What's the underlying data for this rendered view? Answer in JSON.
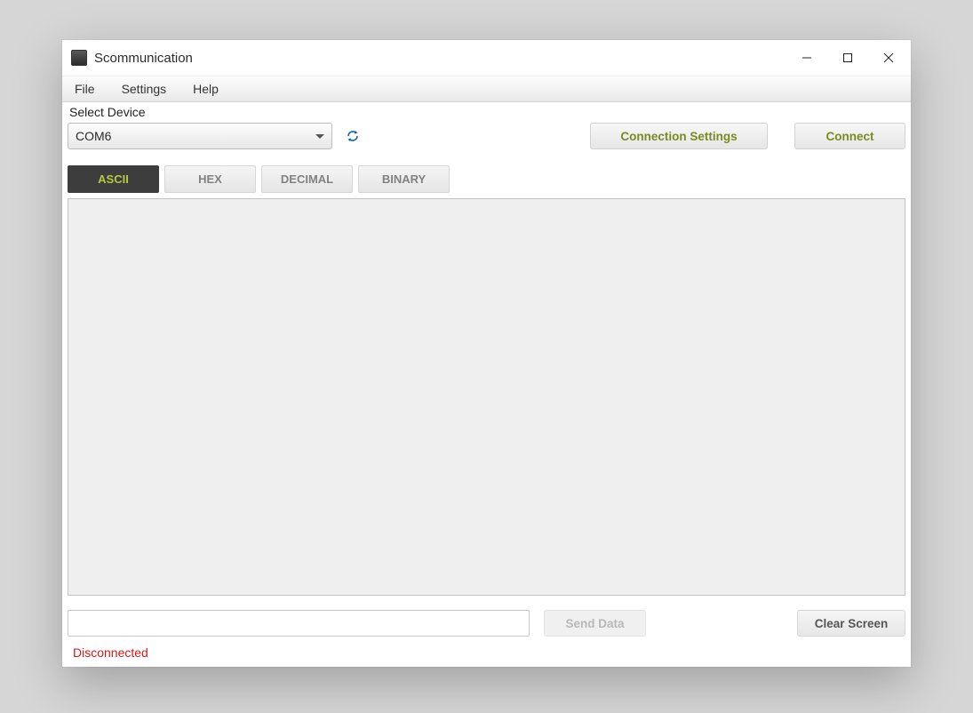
{
  "window": {
    "title": "Scommunication"
  },
  "menu": {
    "file": "File",
    "settings": "Settings",
    "help": "Help"
  },
  "device": {
    "label": "Select Device",
    "selected": "COM6",
    "refresh_icon": "refresh-icon"
  },
  "buttons": {
    "connection_settings": "Connection Settings",
    "connect": "Connect",
    "send": "Send Data",
    "clear": "Clear Screen"
  },
  "tabs": [
    {
      "label": "ASCII",
      "active": true
    },
    {
      "label": "HEX",
      "active": false
    },
    {
      "label": "DECIMAL",
      "active": false
    },
    {
      "label": "BINARY",
      "active": false
    }
  ],
  "output_text": "",
  "input_value": "",
  "status": "Disconnected",
  "colors": {
    "accent_olive": "#7a8a1f",
    "status_red": "#d11a1a"
  }
}
